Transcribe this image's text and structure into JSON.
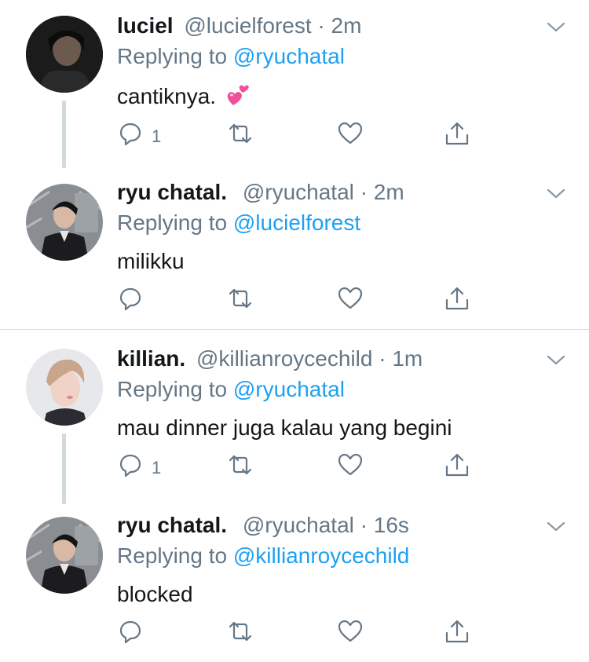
{
  "tweets": [
    {
      "name": "luciel",
      "handle": "@lucielforest",
      "separator": "·",
      "time": "2m",
      "replying_prefix": "Replying to",
      "replying_to": "@ryuchatal",
      "text": "cantiknya.",
      "emoji": "two-hearts",
      "reply_count": "1"
    },
    {
      "name": "ryu chatal.",
      "handle": "@ryuchatal",
      "separator": "·",
      "time": "2m",
      "replying_prefix": "Replying to",
      "replying_to": "@lucielforest",
      "text": "milikku",
      "reply_count": ""
    },
    {
      "name": "killian.",
      "handle": "@killianroycechild",
      "separator": "·",
      "time": "1m",
      "replying_prefix": "Replying to",
      "replying_to": "@ryuchatal",
      "text": "mau dinner juga kalau yang begini",
      "reply_count": "1"
    },
    {
      "name": "ryu chatal.",
      "handle": "@ryuchatal",
      "separator": "·",
      "time": "16s",
      "replying_prefix": "Replying to",
      "replying_to": "@killianroycechild",
      "text": "blocked",
      "reply_count": ""
    }
  ],
  "colors": {
    "accent": "#1da1f2",
    "secondary_text": "#657786",
    "primary_text": "#14171a",
    "thread_line": "#cfd9de",
    "emoji_pink": "#f0509a"
  },
  "icons": [
    "chevron-down-icon",
    "reply-icon",
    "retweet-icon",
    "like-icon",
    "share-icon"
  ]
}
